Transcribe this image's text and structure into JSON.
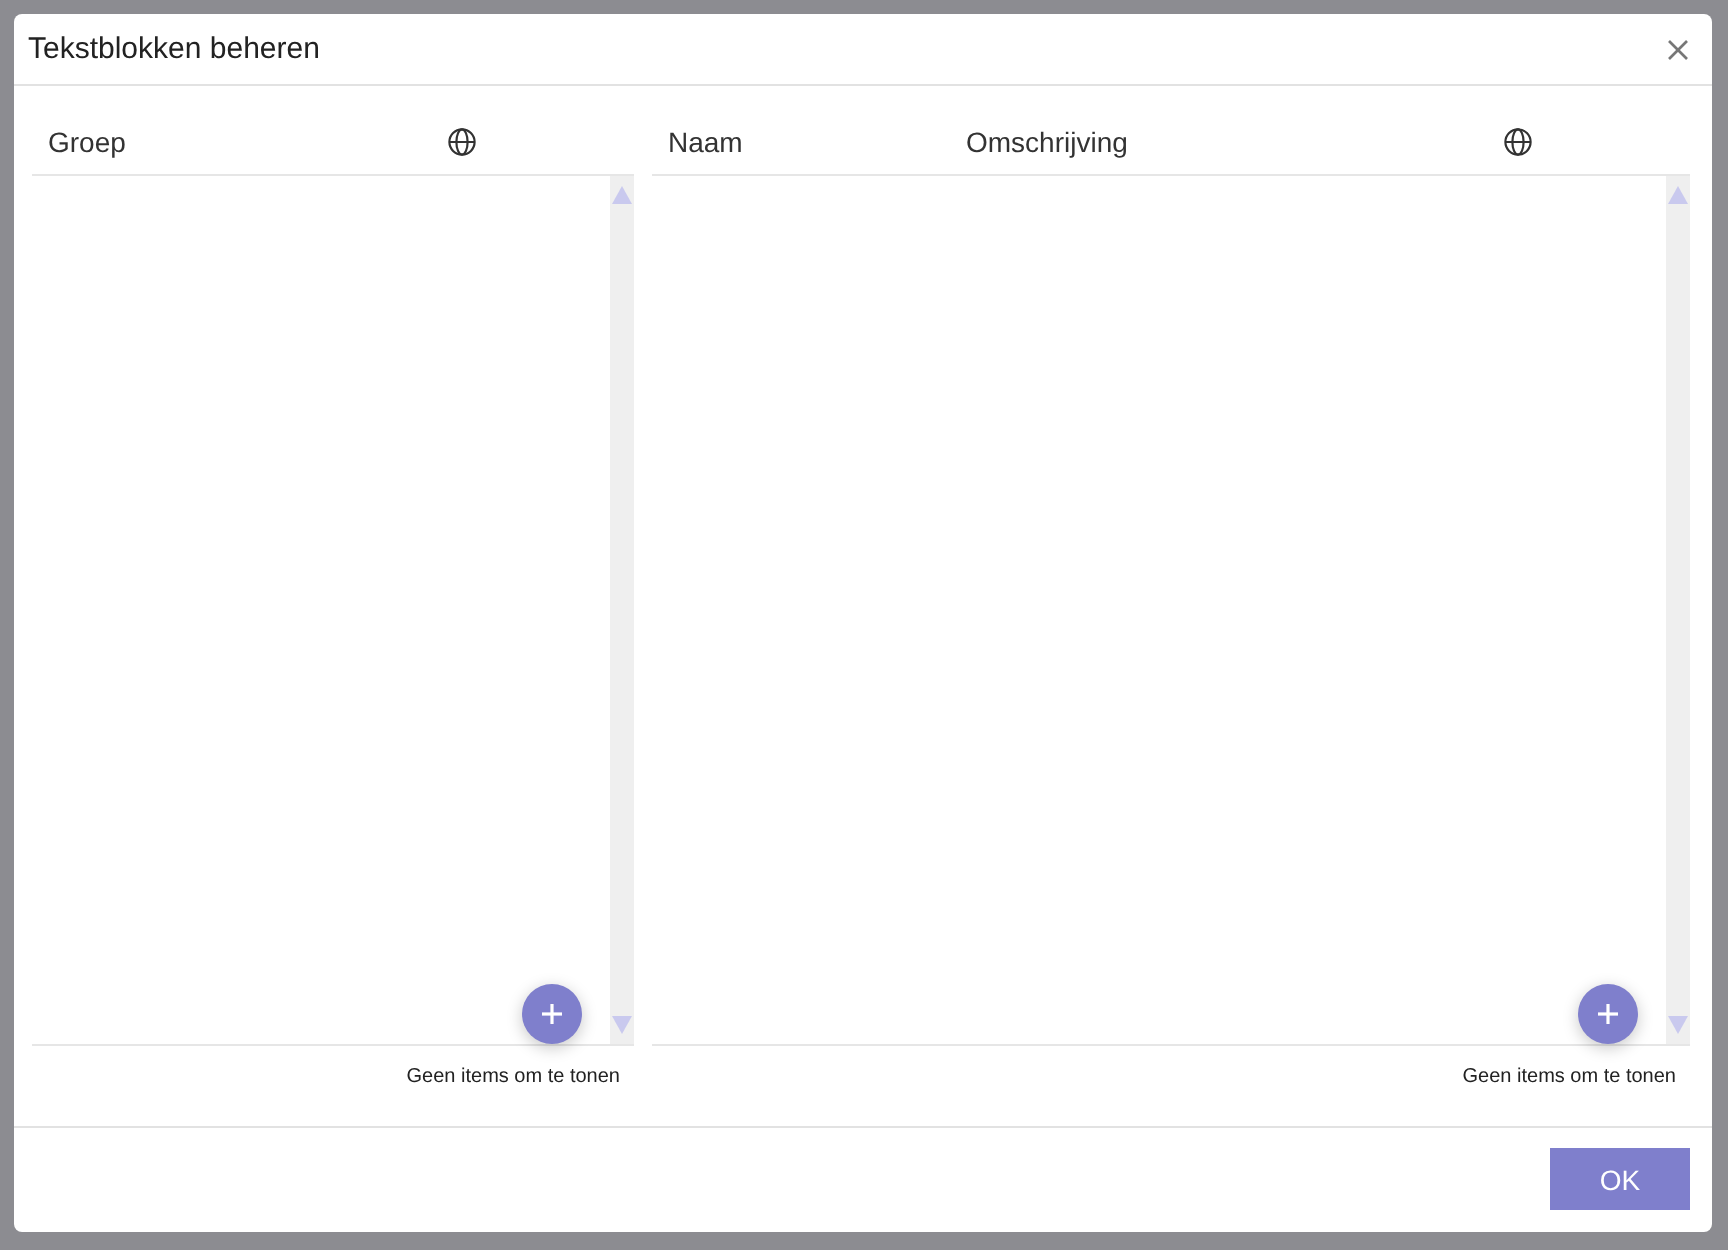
{
  "dialog": {
    "title": "Tekstblokken beheren"
  },
  "panels": [
    {
      "columns": [
        {
          "kind": "text",
          "label": "Groep"
        },
        {
          "kind": "icon"
        }
      ],
      "empty_text": "Geen items om te tonen"
    },
    {
      "columns": [
        {
          "kind": "text",
          "label": "Naam"
        },
        {
          "kind": "text",
          "label": "Omschrijving"
        },
        {
          "kind": "icon"
        }
      ],
      "empty_text": "Geen items om te tonen"
    }
  ],
  "buttons": [
    {
      "label": "OK"
    }
  ]
}
